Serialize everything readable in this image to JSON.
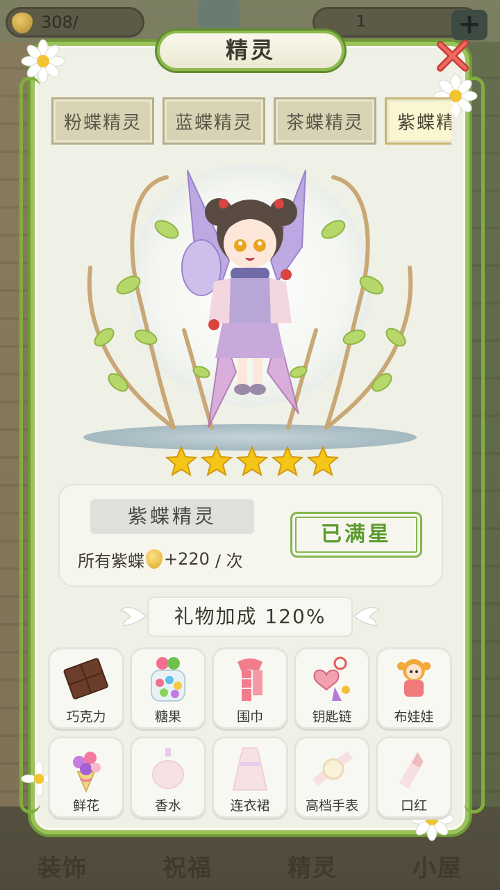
{
  "topbar": {
    "coins": "308/",
    "gems": "1"
  },
  "bottom_nav": [
    "装饰",
    "祝福",
    "精灵",
    "小屋"
  ],
  "modal": {
    "title": "精灵",
    "tabs": [
      {
        "label": "粉蝶精灵",
        "active": false
      },
      {
        "label": "蓝蝶精灵",
        "active": false
      },
      {
        "label": "茶蝶精灵",
        "active": false
      },
      {
        "label": "紫蝶精灵",
        "active": true
      }
    ],
    "stars": 5,
    "sprite": {
      "name": "紫蝶精灵",
      "bonus_prefix": "所有紫蝶",
      "bonus_value": "+220",
      "bonus_suffix": "/ 次",
      "status_button": "已满星"
    },
    "gift_bonus": "礼物加成 120%",
    "gifts": [
      {
        "label": "巧克力",
        "icon": "chocolate-icon",
        "owned": true
      },
      {
        "label": "糖果",
        "icon": "candy-jar-icon",
        "owned": true
      },
      {
        "label": "围巾",
        "icon": "scarf-icon",
        "owned": true
      },
      {
        "label": "钥匙链",
        "icon": "keychain-icon",
        "owned": true
      },
      {
        "label": "布娃娃",
        "icon": "doll-icon",
        "owned": true
      },
      {
        "label": "鲜花",
        "icon": "bouquet-icon",
        "owned": true
      },
      {
        "label": "香水",
        "icon": "perfume-icon",
        "owned": false
      },
      {
        "label": "连衣裙",
        "icon": "dress-icon",
        "owned": false
      },
      {
        "label": "高档手表",
        "icon": "watch-icon",
        "owned": false
      },
      {
        "label": "口红",
        "icon": "lipstick-icon",
        "owned": false
      }
    ]
  },
  "colors": {
    "vine_green": "#7fae3e",
    "maxed_green": "#5c9a2e",
    "star_gold": "#f5c518",
    "wing_purple": "#a48ad8"
  }
}
